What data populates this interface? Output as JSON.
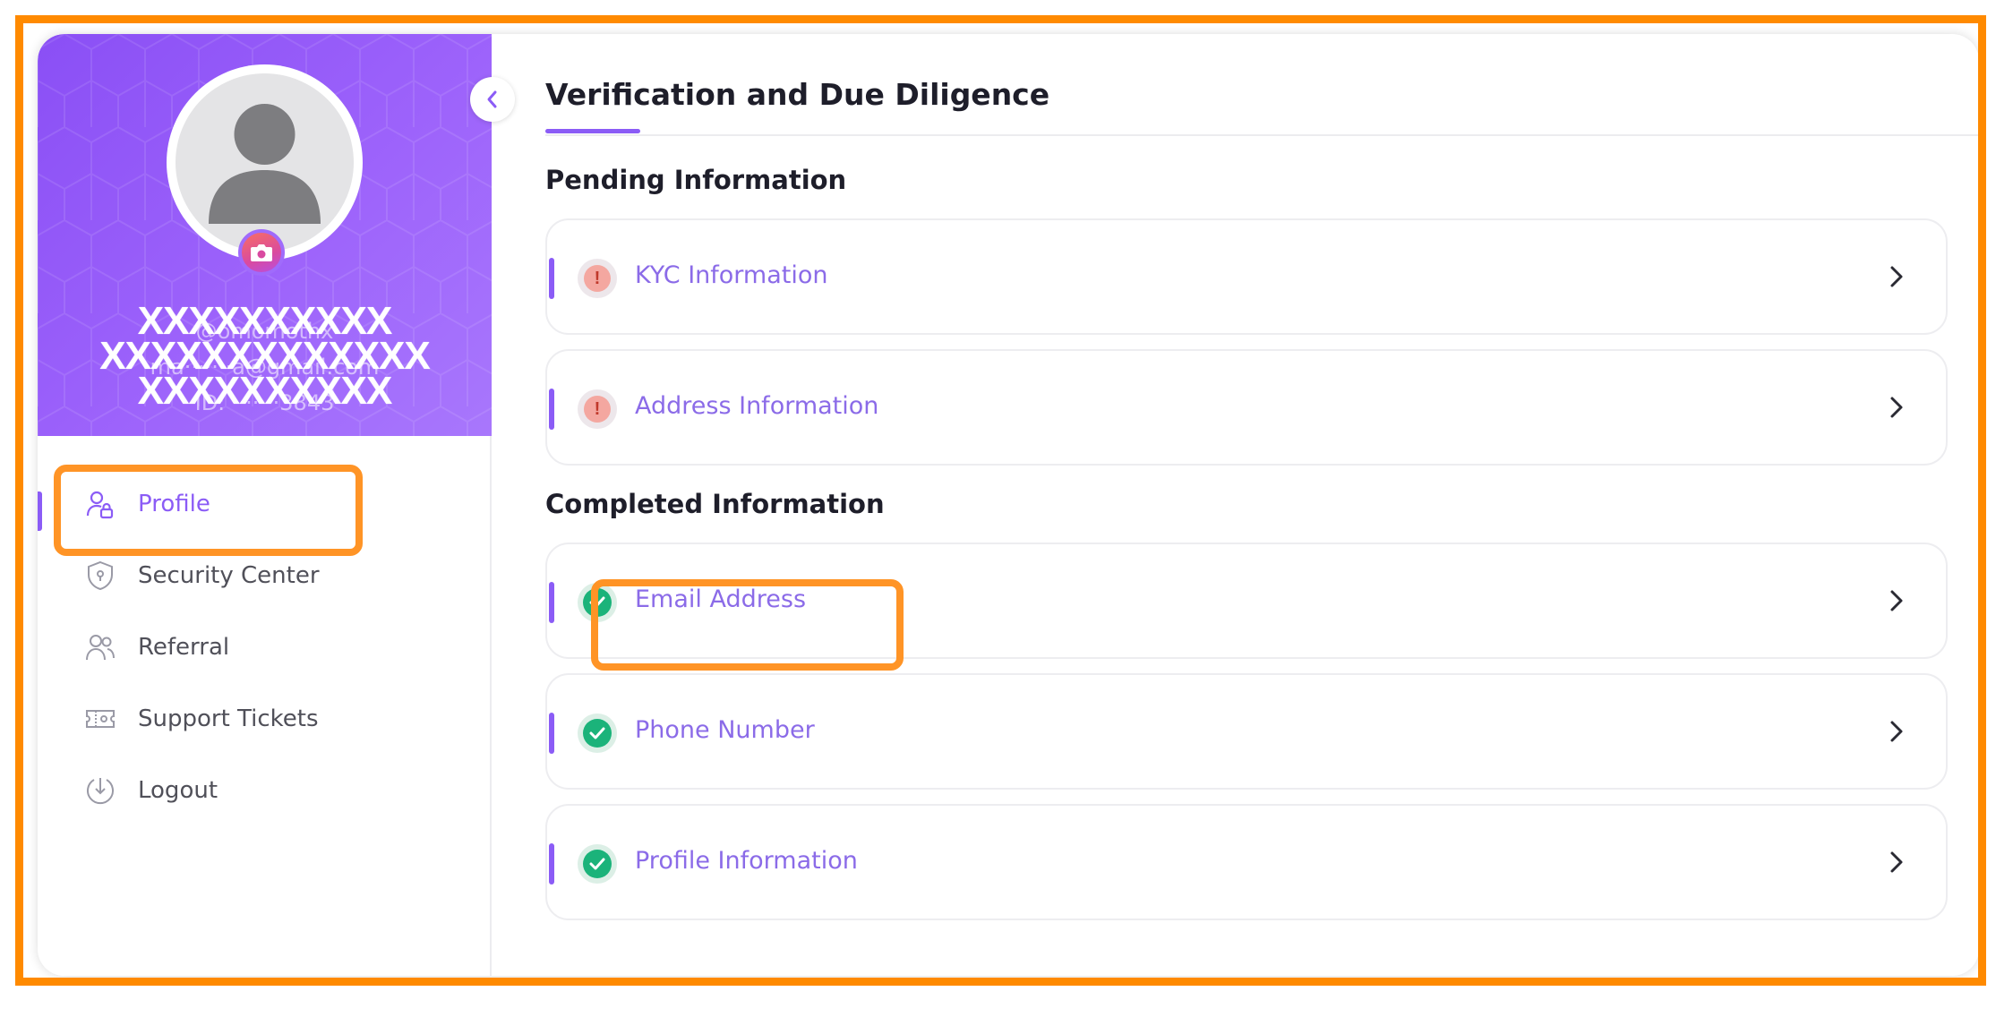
{
  "user": {
    "name_masked": "XXXXXXXXXX",
    "email_masked": "XXXXXXXXXXXXX",
    "id_masked": "XXXXXXXXXX",
    "name_under": "@omomothx",
    "email_under": "ma·······a@gmail.com",
    "id_under": "ID: ·······3843"
  },
  "sidebar": {
    "items": [
      {
        "label": "Profile",
        "icon": "user-lock-icon",
        "active": true
      },
      {
        "label": "Security Center",
        "icon": "shield-icon",
        "active": false
      },
      {
        "label": "Referral",
        "icon": "users-icon",
        "active": false
      },
      {
        "label": "Support Tickets",
        "icon": "ticket-icon",
        "active": false
      },
      {
        "label": "Logout",
        "icon": "logout-icon",
        "active": false
      }
    ]
  },
  "main": {
    "title": "Verification and Due Diligence",
    "pending": {
      "title": "Pending Information",
      "items": [
        {
          "label": "KYC Information",
          "status": "pending"
        },
        {
          "label": "Address Information",
          "status": "pending"
        }
      ]
    },
    "completed": {
      "title": "Completed Information",
      "items": [
        {
          "label": "Email Address",
          "status": "completed"
        },
        {
          "label": "Phone Number",
          "status": "completed"
        },
        {
          "label": "Profile Information",
          "status": "completed"
        }
      ]
    }
  },
  "colors": {
    "accent": "#8b5cf6",
    "highlight": "#ff8a00",
    "success": "#1bb37a",
    "warning": "#f4a7a0"
  }
}
